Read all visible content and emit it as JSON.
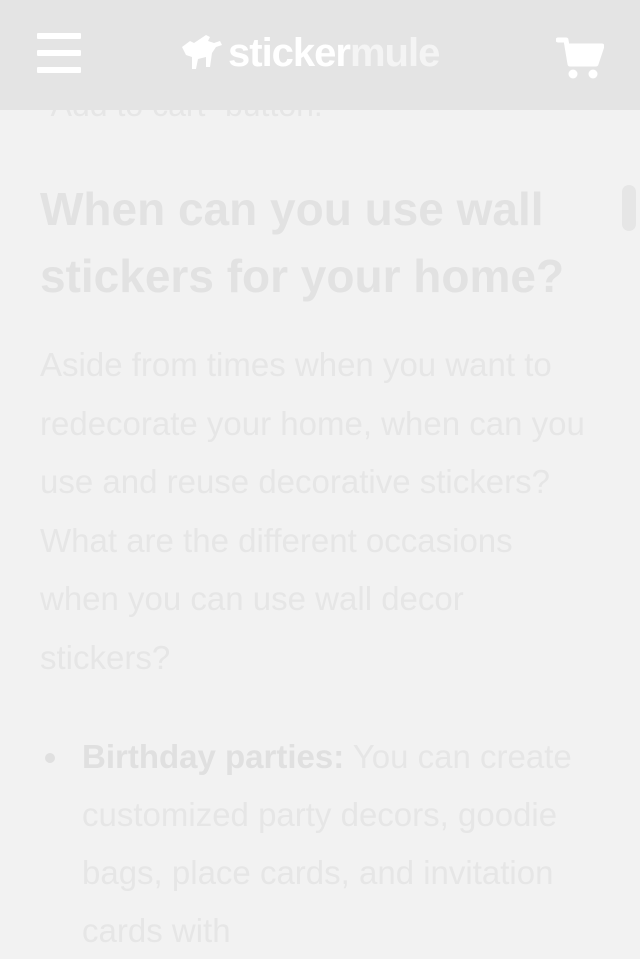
{
  "header": {
    "logo_word1": "sticker",
    "logo_word2": "mule",
    "menu_icon": "hamburger-icon",
    "cart_icon": "cart-icon"
  },
  "content": {
    "cutoff_text": "“Add to cart” button.",
    "heading": "When can you use wall stickers for your home?",
    "paragraph": "Aside from times when you want to redecorate your home, when can you use and reuse decorative stickers? What are the different occasions when you can use wall decor stickers?",
    "bullets": [
      {
        "title": "Birthday parties:",
        "text": " You can create customized party decors, goodie bags, place cards, and invitation cards with"
      }
    ]
  },
  "colors": {
    "header_bg": "#e4e4e4",
    "page_bg": "#f2f2f2",
    "text": "#e6e6e6"
  }
}
